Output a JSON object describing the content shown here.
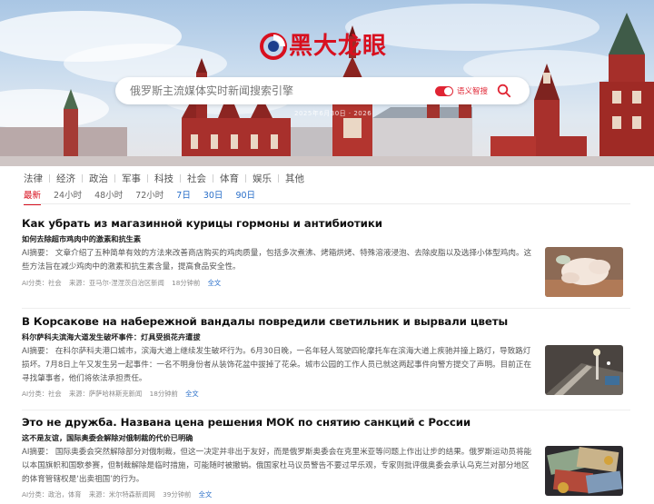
{
  "brand": {
    "name": "黑大龙眼",
    "color": "#d8101f"
  },
  "search": {
    "placeholder": "俄罗斯主流媒体实时新闻搜索引擎",
    "toggle_label": "语义智搜",
    "icon": "search-icon"
  },
  "hero": {
    "date_text": "2025年6月30日 · 2026"
  },
  "categories": [
    "法律",
    "经济",
    "政治",
    "军事",
    "科技",
    "社会",
    "体育",
    "娱乐",
    "其他"
  ],
  "time_filters": [
    "最新",
    "24小时",
    "48小时",
    "72小时",
    "7日",
    "30日",
    "90日"
  ],
  "articles": [
    {
      "title": "Как убрать из магазинной курицы гормоны и антибиотики",
      "subtitle": "如何去除超市鸡肉中的激素和抗生素",
      "summary": "AI摘要： 文章介绍了五种简单有效的方法来改善商店购买的鸡肉质量，包括多次煮沸、烤箱烘烤、特殊溶液浸泡、去除皮脂以及选择小体型鸡肉。这些方法旨在减少鸡肉中的激素和抗生素含量，提高食品安全性。",
      "category": "AI分类：社会",
      "source": "来源：亚马尔-涅涅茨自治区新闻",
      "time": "18分钟前",
      "full_text": "全文"
    },
    {
      "title": "В Корсакове на набережной вандалы повредили светильник и вырвали цветы",
      "subtitle": "科尔萨科夫滨海大道发生破坏事件：灯具受损花卉遭拔",
      "summary": "AI摘要： 在科尔萨科夫港口城市，滨海大道上继续发生破坏行为。6月30日晚，一名年轻人驾驶四轮摩托车在滨海大道上疾驰并撞上路灯，导致路灯损坏。7月8日上午又发生另一起事件：一名不明身份者从装饰花盆中拔掉了花朵。城市公园的工作人员已就这两起事件向警方提交了声明。目前正在寻找肇事者，他们将依法承担责任。",
      "category": "AI分类：社会",
      "source": "来源：萨萨哈林斯克新闻",
      "time": "18分钟前",
      "full_text": "全文"
    },
    {
      "title": "Это не дружба. Названа цена решения МОК по снятию санкций с России",
      "subtitle": "这不是友谊，国际奥委会解除对俄制裁的代价已明确",
      "summary": "AI摘要： 国际奥委会突然解除部分对俄制裁，但这一决定并非出于友好，而是俄罗斯奥委会在克里米亚等问题上作出让步的结果。俄罗斯运动员将能以本国旗帜和国歌参赛，但制裁解除是临时措施，可能随时被撤销。俄国家杜马议员警告不要过早乐观，专家则批评俄奥委会承认乌克兰对部分地区的体育管辖权是‘出卖祖国’的行为。",
      "category": "AI分类：政治，体育",
      "source": "来源：米尔特森新闻网",
      "time": "39分钟前",
      "full_text": "全文"
    }
  ]
}
